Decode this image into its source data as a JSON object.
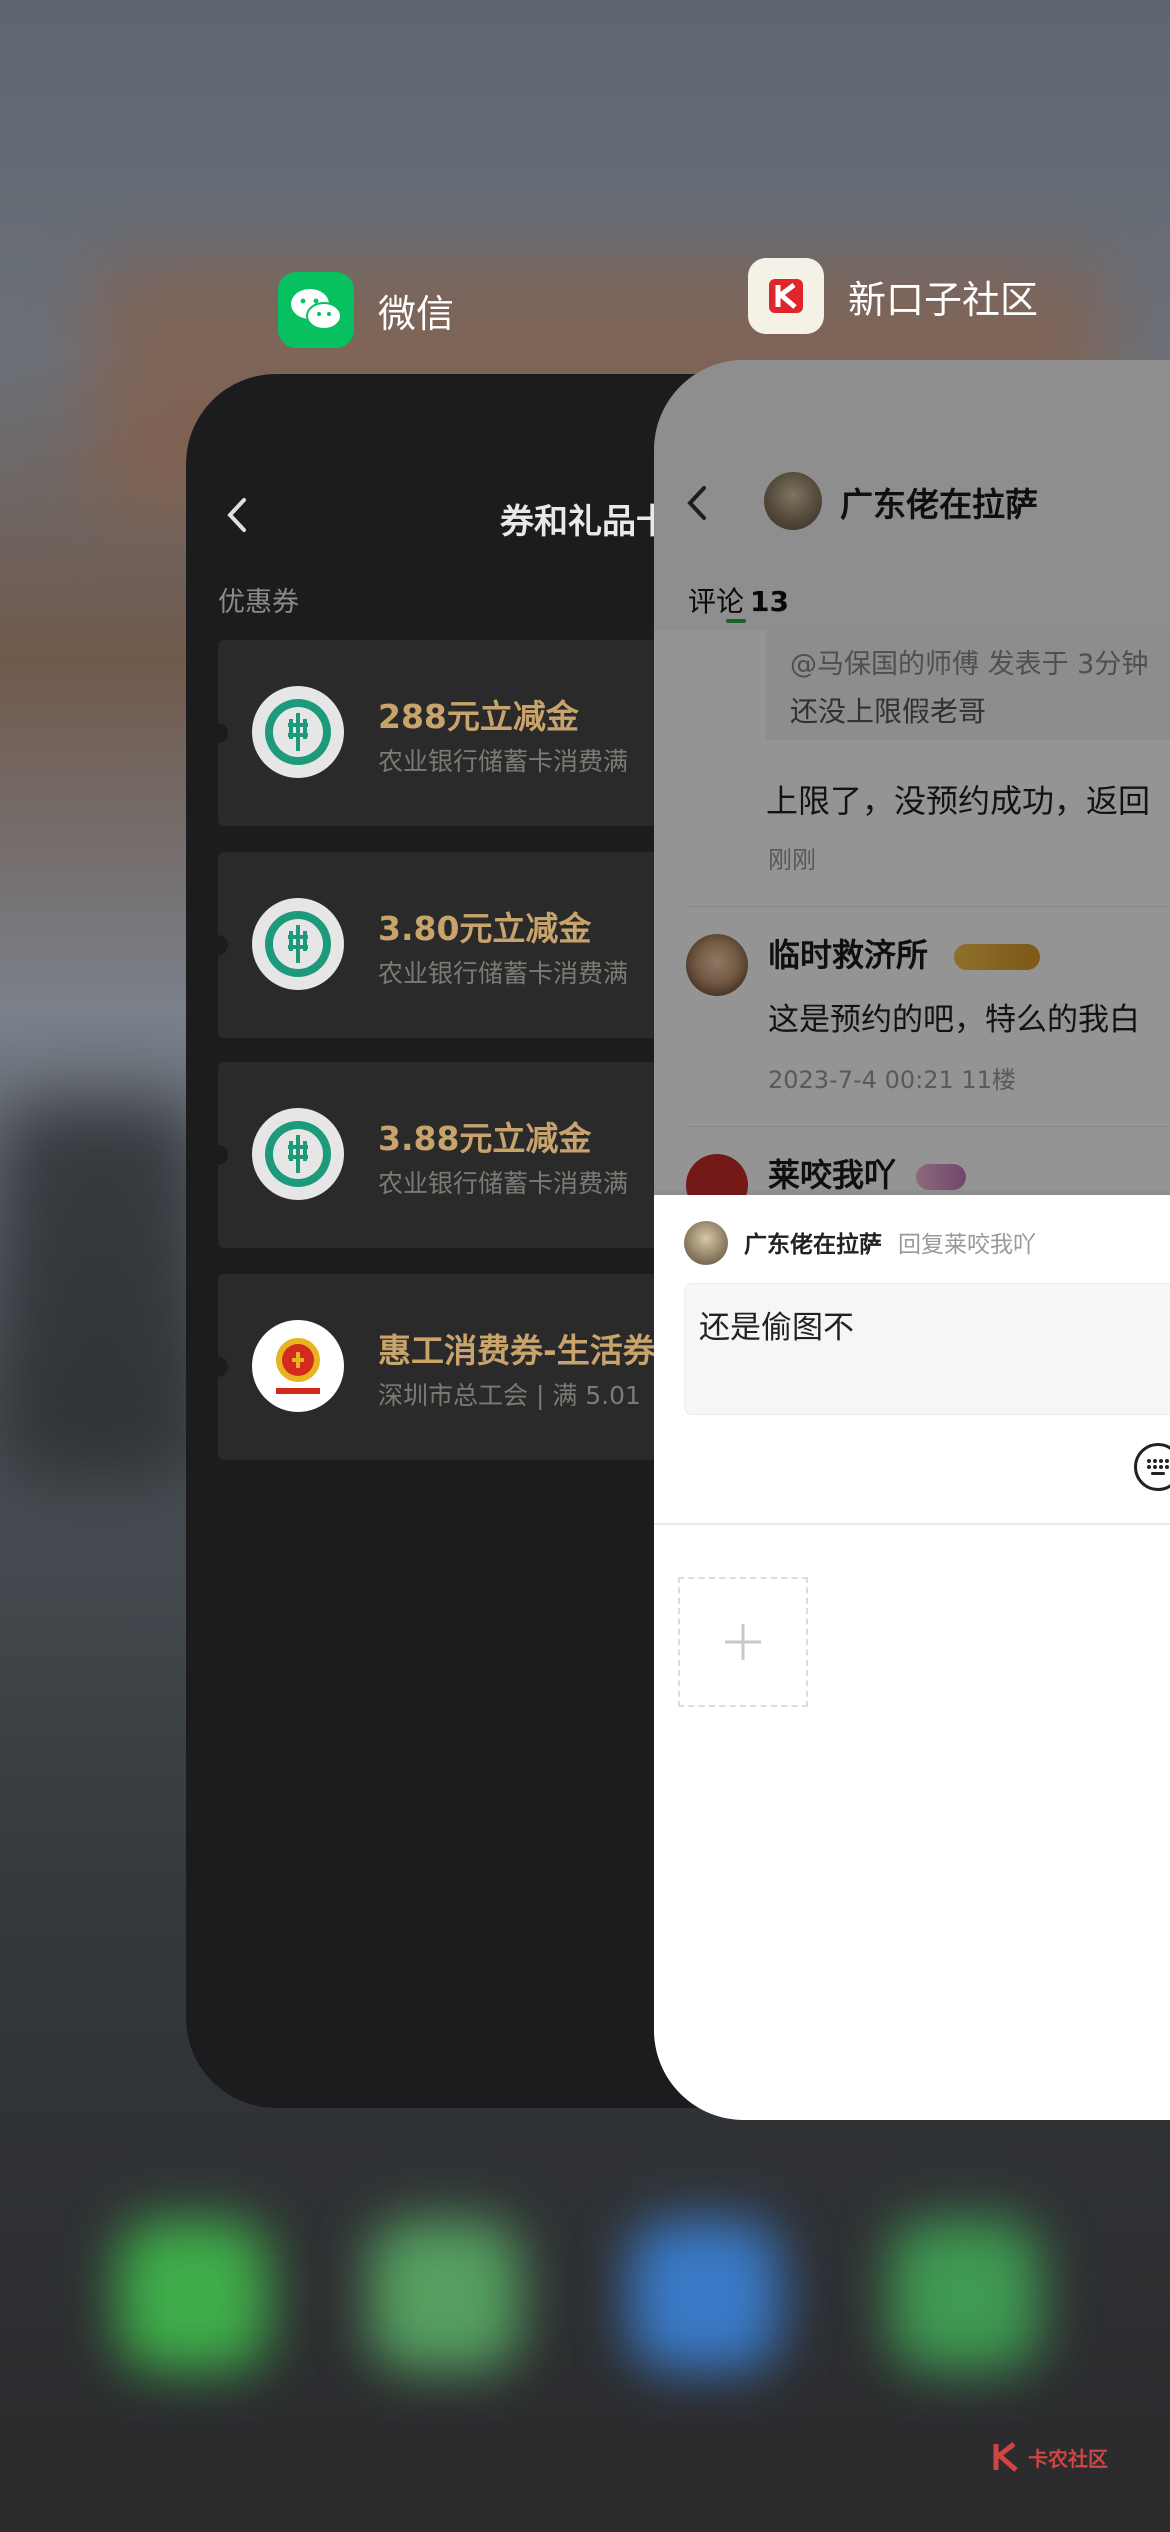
{
  "apps": {
    "wechat": {
      "name": "微信",
      "icon": "wechat-icon",
      "color": "#07c160"
    },
    "community": {
      "name": "新口子社区",
      "icon": "k-logo-icon",
      "color": "#e0262b"
    }
  },
  "wechat_card": {
    "title": "券和礼品卡",
    "section_label": "优惠券",
    "coupons": [
      {
        "title": "288元立减金",
        "subtitle": "农业银行储蓄卡消费满",
        "logo": "abc-bank-logo"
      },
      {
        "title": "3.80元立减金",
        "subtitle": "农业银行储蓄卡消费满",
        "logo": "abc-bank-logo"
      },
      {
        "title": "3.88元立减金",
        "subtitle": "农业银行储蓄卡消费满",
        "logo": "abc-bank-logo"
      },
      {
        "title": "惠工消费券-生活券",
        "subtitle": "深圳市总工会 | 满 5.01",
        "logo": "trade-union-logo"
      }
    ],
    "accent_color": "#c8a46c"
  },
  "community_card": {
    "username": "广东佬在拉萨",
    "tab_label": "评论",
    "tab_count": "13",
    "quoted_meta": "@马保国的师傅 发表于 3分钟",
    "quoted_text": "还没上限假老哥",
    "reply_text": "上限了，没预约成功，返回",
    "reply_time": "刚刚",
    "comments": [
      {
        "name": "临时救济所",
        "text": "这是预约的吧，特么的我白",
        "meta": "2023-7-4 00:21  11楼"
      },
      {
        "name": "莱咬我吖",
        "text": "",
        "meta": ""
      }
    ],
    "reply_panel": {
      "user": "广东佬在拉萨",
      "reply_to": "回复莱咬我吖",
      "input_value": "还是偷图不"
    }
  },
  "watermark": "卡农社区"
}
